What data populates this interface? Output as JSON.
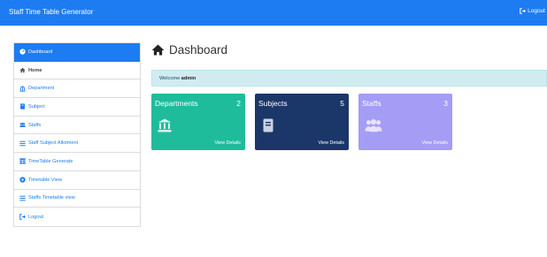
{
  "topbar": {
    "brand": "Staff Time Table Generator",
    "logout": "Logout"
  },
  "sidebar": {
    "items": [
      {
        "label": "Dashboard",
        "icon": "dashboard-icon"
      },
      {
        "label": "Home",
        "icon": "home-icon"
      },
      {
        "label": "Department",
        "icon": "university-icon"
      },
      {
        "label": "Subject",
        "icon": "book-icon"
      },
      {
        "label": "Staffs",
        "icon": "users-icon"
      },
      {
        "label": "Staff Subject Allotment",
        "icon": "list-icon"
      },
      {
        "label": "TimeTable Generate",
        "icon": "table-icon"
      },
      {
        "label": "Timetable View",
        "icon": "eye-icon"
      },
      {
        "label": "Staffs Timetable view",
        "icon": "list-icon"
      },
      {
        "label": "Logout",
        "icon": "sign-out-icon"
      }
    ]
  },
  "main": {
    "title": "Dashboard",
    "welcome_prefix": "Welcome",
    "welcome_user": "admin"
  },
  "cards": [
    {
      "title": "Departments",
      "count": "2",
      "link": "View Details",
      "color": "#1fbc9c",
      "icon": "university-icon"
    },
    {
      "title": "Subjects",
      "count": "5",
      "link": "View Details",
      "color": "#1b3668",
      "icon": "book-icon"
    },
    {
      "title": "Staffs",
      "count": "3",
      "link": "View Details",
      "color": "#a59cf5",
      "icon": "users-icon"
    }
  ],
  "colors": {
    "primary": "#1e7cf2",
    "alert_bg": "#d1ecf1"
  }
}
